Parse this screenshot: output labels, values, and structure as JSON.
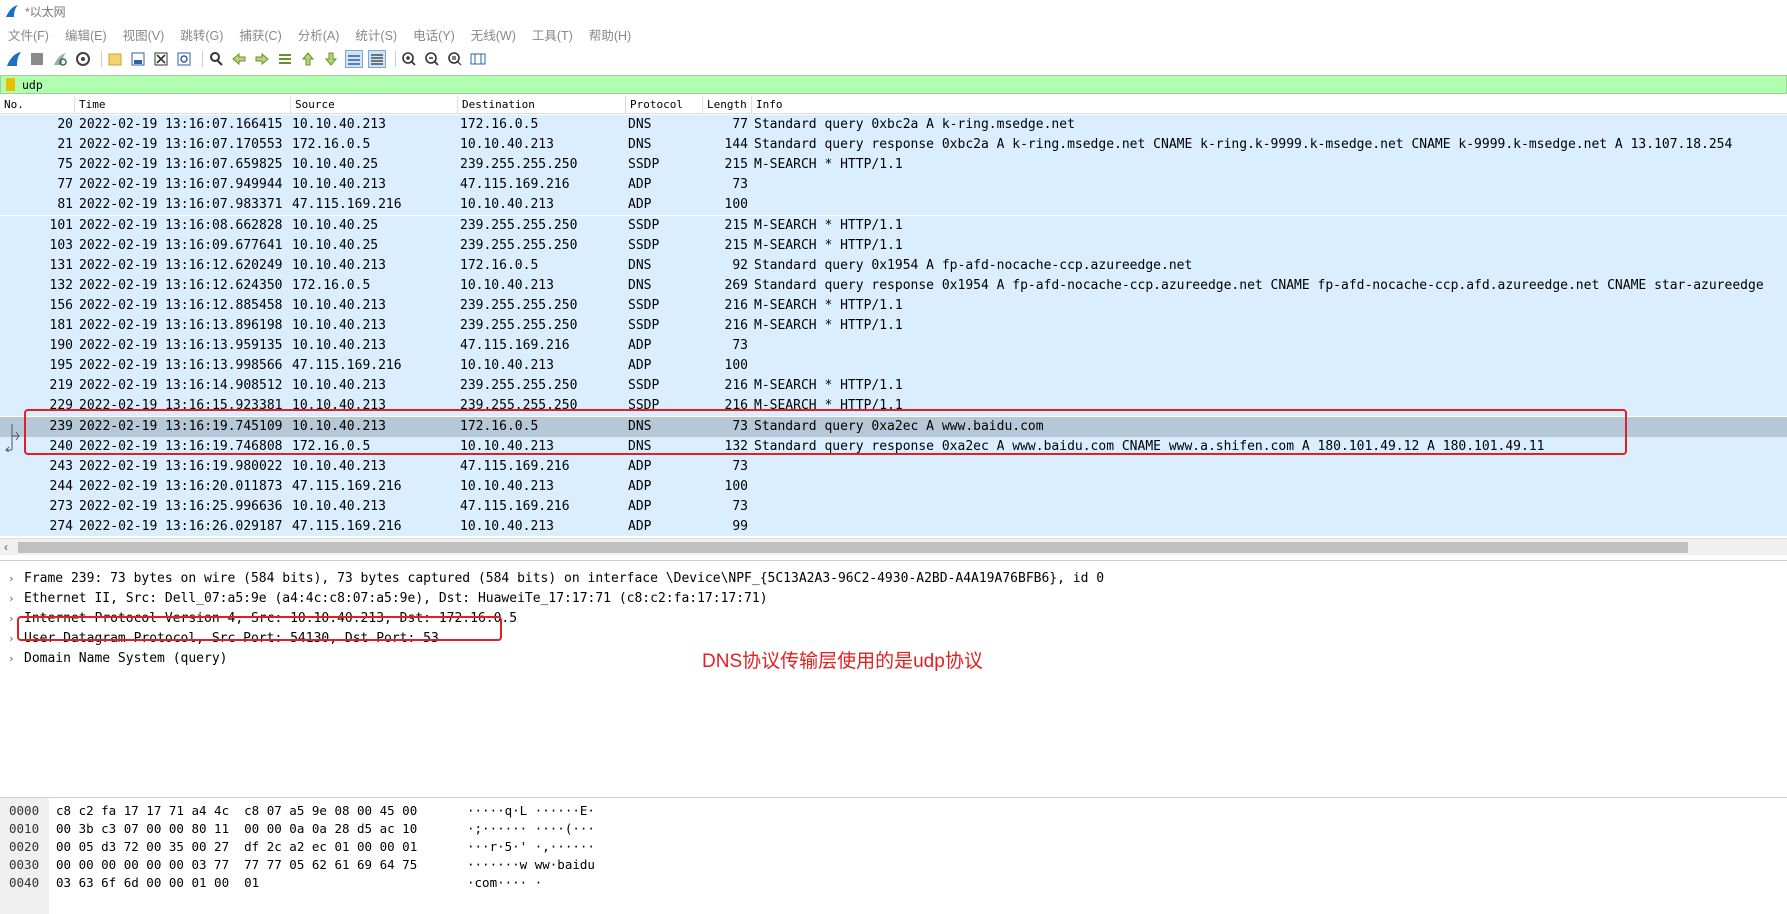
{
  "window": {
    "title": "*以太网"
  },
  "menu": [
    "文件(F)",
    "编辑(E)",
    "视图(V)",
    "跳转(G)",
    "捕获(C)",
    "分析(A)",
    "统计(S)",
    "电话(Y)",
    "无线(W)",
    "工具(T)",
    "帮助(H)"
  ],
  "toolbar": {
    "icons": [
      "shark-fin-start-icon",
      "stop-icon",
      "restart-icon",
      "options-gear-icon",
      "open-folder-icon",
      "save-file-icon",
      "close-file-icon",
      "reload-icon",
      "find-icon",
      "back-arrow-icon",
      "forward-arrow-icon",
      "goto-packet-icon",
      "first-packet-icon",
      "last-packet-icon",
      "autoscroll-icon",
      "colorize-icon",
      "zoom-in-icon",
      "zoom-out-icon",
      "zoom-normal-icon",
      "resize-columns-icon"
    ]
  },
  "filter": {
    "value": "udp"
  },
  "packet_list": {
    "columns": [
      "No.",
      "Time",
      "Source",
      "Destination",
      "Protocol",
      "Length",
      "Info"
    ],
    "rows": [
      {
        "no": "20",
        "time": "2022-02-19 13:16:07.166415",
        "src": "10.10.40.213",
        "dst": "172.16.0.5",
        "proto": "DNS",
        "len": "77",
        "info": "Standard query 0xbc2a A k-ring.msedge.net"
      },
      {
        "no": "21",
        "time": "2022-02-19 13:16:07.170553",
        "src": "172.16.0.5",
        "dst": "10.10.40.213",
        "proto": "DNS",
        "len": "144",
        "info": "Standard query response 0xbc2a A k-ring.msedge.net CNAME k-ring.k-9999.k-msedge.net CNAME k-9999.k-msedge.net A 13.107.18.254"
      },
      {
        "no": "75",
        "time": "2022-02-19 13:16:07.659825",
        "src": "10.10.40.25",
        "dst": "239.255.255.250",
        "proto": "SSDP",
        "len": "215",
        "info": "M-SEARCH * HTTP/1.1"
      },
      {
        "no": "77",
        "time": "2022-02-19 13:16:07.949944",
        "src": "10.10.40.213",
        "dst": "47.115.169.216",
        "proto": "ADP",
        "len": "73",
        "info": ""
      },
      {
        "no": "81",
        "time": "2022-02-19 13:16:07.983371",
        "src": "47.115.169.216",
        "dst": "10.10.40.213",
        "proto": "ADP",
        "len": "100",
        "info": ""
      },
      {
        "no": "101",
        "time": "2022-02-19 13:16:08.662828",
        "src": "10.10.40.25",
        "dst": "239.255.255.250",
        "proto": "SSDP",
        "len": "215",
        "info": "M-SEARCH * HTTP/1.1"
      },
      {
        "no": "103",
        "time": "2022-02-19 13:16:09.677641",
        "src": "10.10.40.25",
        "dst": "239.255.255.250",
        "proto": "SSDP",
        "len": "215",
        "info": "M-SEARCH * HTTP/1.1"
      },
      {
        "no": "131",
        "time": "2022-02-19 13:16:12.620249",
        "src": "10.10.40.213",
        "dst": "172.16.0.5",
        "proto": "DNS",
        "len": "92",
        "info": "Standard query 0x1954 A fp-afd-nocache-ccp.azureedge.net"
      },
      {
        "no": "132",
        "time": "2022-02-19 13:16:12.624350",
        "src": "172.16.0.5",
        "dst": "10.10.40.213",
        "proto": "DNS",
        "len": "269",
        "info": "Standard query response 0x1954 A fp-afd-nocache-ccp.azureedge.net CNAME fp-afd-nocache-ccp.afd.azureedge.net CNAME star-azureedge"
      },
      {
        "no": "156",
        "time": "2022-02-19 13:16:12.885458",
        "src": "10.10.40.213",
        "dst": "239.255.255.250",
        "proto": "SSDP",
        "len": "216",
        "info": "M-SEARCH * HTTP/1.1"
      },
      {
        "no": "181",
        "time": "2022-02-19 13:16:13.896198",
        "src": "10.10.40.213",
        "dst": "239.255.255.250",
        "proto": "SSDP",
        "len": "216",
        "info": "M-SEARCH * HTTP/1.1"
      },
      {
        "no": "190",
        "time": "2022-02-19 13:16:13.959135",
        "src": "10.10.40.213",
        "dst": "47.115.169.216",
        "proto": "ADP",
        "len": "73",
        "info": ""
      },
      {
        "no": "195",
        "time": "2022-02-19 13:16:13.998566",
        "src": "47.115.169.216",
        "dst": "10.10.40.213",
        "proto": "ADP",
        "len": "100",
        "info": ""
      },
      {
        "no": "219",
        "time": "2022-02-19 13:16:14.908512",
        "src": "10.10.40.213",
        "dst": "239.255.255.250",
        "proto": "SSDP",
        "len": "216",
        "info": "M-SEARCH * HTTP/1.1"
      },
      {
        "no": "229",
        "time": "2022-02-19 13:16:15.923381",
        "src": "10.10.40.213",
        "dst": "239.255.255.250",
        "proto": "SSDP",
        "len": "216",
        "info": "M-SEARCH * HTTP/1.1"
      },
      {
        "no": "239",
        "time": "2022-02-19 13:16:19.745109",
        "src": "10.10.40.213",
        "dst": "172.16.0.5",
        "proto": "DNS",
        "len": "73",
        "info": "Standard query 0xa2ec A www.baidu.com",
        "selected": true
      },
      {
        "no": "240",
        "time": "2022-02-19 13:16:19.746808",
        "src": "172.16.0.5",
        "dst": "10.10.40.213",
        "proto": "DNS",
        "len": "132",
        "info": "Standard query response 0xa2ec A www.baidu.com CNAME www.a.shifen.com A 180.101.49.12 A 180.101.49.11"
      },
      {
        "no": "243",
        "time": "2022-02-19 13:16:19.980022",
        "src": "10.10.40.213",
        "dst": "47.115.169.216",
        "proto": "ADP",
        "len": "73",
        "info": ""
      },
      {
        "no": "244",
        "time": "2022-02-19 13:16:20.011873",
        "src": "47.115.169.216",
        "dst": "10.10.40.213",
        "proto": "ADP",
        "len": "100",
        "info": ""
      },
      {
        "no": "273",
        "time": "2022-02-19 13:16:25.996636",
        "src": "10.10.40.213",
        "dst": "47.115.169.216",
        "proto": "ADP",
        "len": "73",
        "info": ""
      },
      {
        "no": "274",
        "time": "2022-02-19 13:16:26.029187",
        "src": "47.115.169.216",
        "dst": "10.10.40.213",
        "proto": "ADP",
        "len": "99",
        "info": ""
      }
    ]
  },
  "details": {
    "rows": [
      "Frame 239: 73 bytes on wire (584 bits), 73 bytes captured (584 bits) on interface \\Device\\NPF_{5C13A2A3-96C2-4930-A2BD-A4A19A76BFB6}, id 0",
      "Ethernet II, Src: Dell_07:a5:9e (a4:4c:c8:07:a5:9e), Dst: HuaweiTe_17:17:71 (c8:c2:fa:17:17:71)",
      "Internet Protocol Version 4, Src: 10.10.40.213, Dst: 172.16.0.5",
      "User Datagram Protocol, Src Port: 54130, Dst Port: 53",
      "Domain Name System (query)"
    ]
  },
  "annotation": {
    "text": "DNS协议传输层使用的是udp协议",
    "color": "#e32020"
  },
  "hex": {
    "rows": [
      {
        "offset": "0000",
        "bytes": "c8 c2 fa 17 17 71 a4 4c  c8 07 a5 9e 08 00 45 00",
        "ascii": "·····q·L ······E·"
      },
      {
        "offset": "0010",
        "bytes": "00 3b c3 07 00 00 80 11  00 00 0a 0a 28 d5 ac 10",
        "ascii": "·;······ ····(···"
      },
      {
        "offset": "0020",
        "bytes": "00 05 d3 72 00 35 00 27  df 2c a2 ec 01 00 00 01",
        "ascii": "···r·5·' ·,······"
      },
      {
        "offset": "0030",
        "bytes": "00 00 00 00 00 00 03 77  77 77 05 62 61 69 64 75",
        "ascii": "·······w ww·baidu"
      },
      {
        "offset": "0040",
        "bytes": "03 63 6f 6d 00 00 01 00  01",
        "ascii": "·com···· ·"
      }
    ]
  },
  "colors": {
    "filter_bg": "#afffaf",
    "row_bg": "#daeeff",
    "selected_bg": "#b6c8d8",
    "highlight": "#e32020"
  }
}
